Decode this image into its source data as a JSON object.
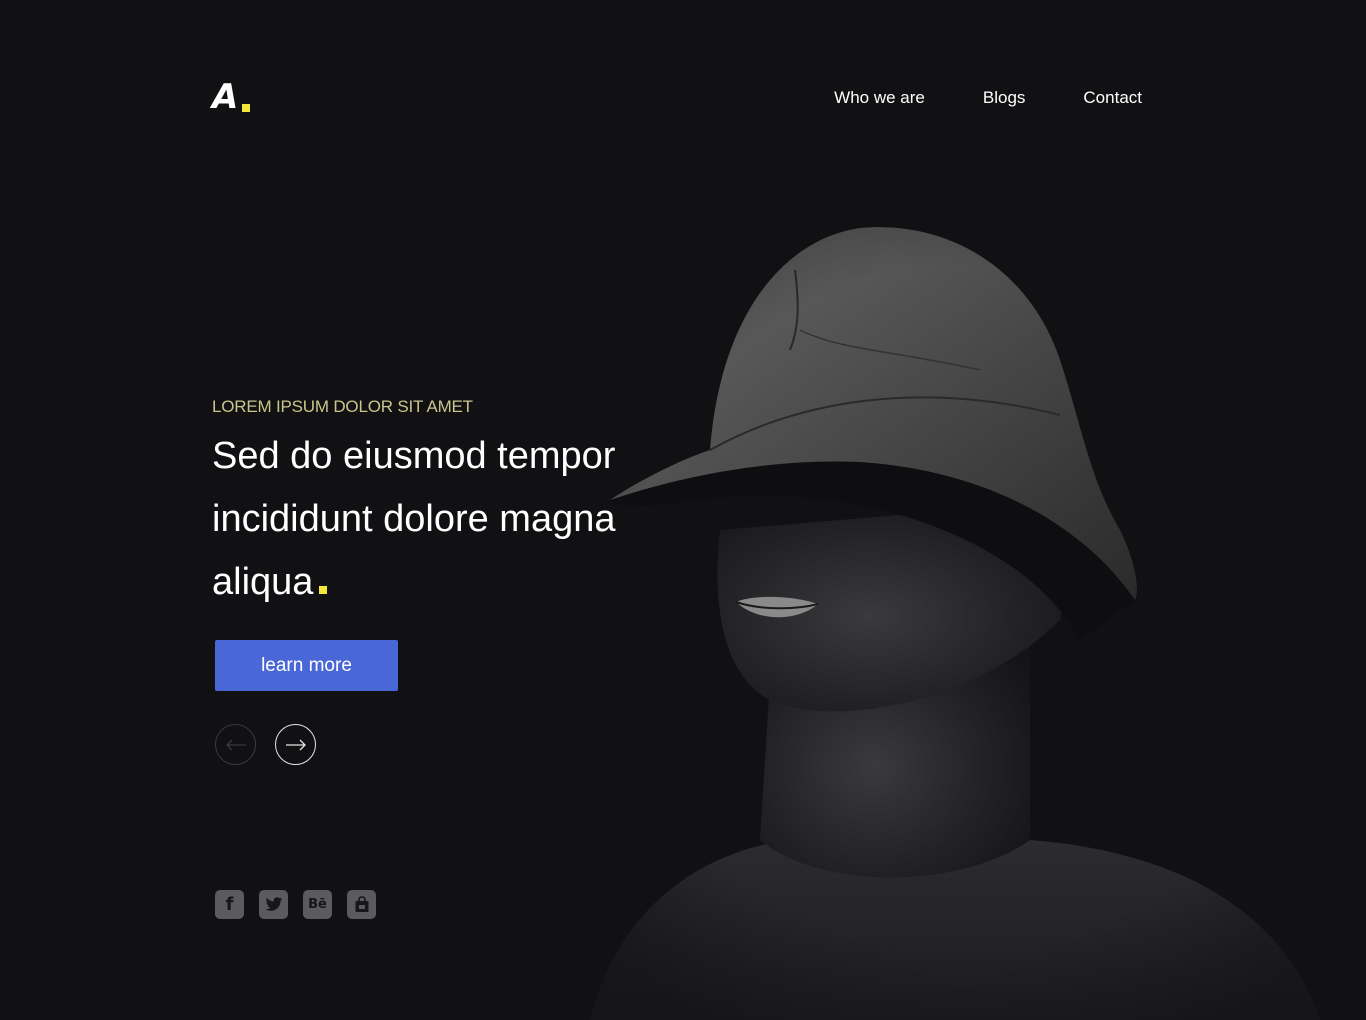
{
  "brand": {
    "logo_letter": "A",
    "accent_color": "#f5e63a"
  },
  "nav": {
    "items": [
      {
        "label": "Who we are"
      },
      {
        "label": "Blogs"
      },
      {
        "label": "Contact"
      }
    ]
  },
  "hero": {
    "eyebrow": "LOREM IPSUM DOLOR SIT AMET",
    "headline": "Sed do eiusmod tempor incididunt dolore magna aliqua",
    "cta_label": "learn more",
    "cta_color": "#4a67d8",
    "prev_icon": "arrow-left-icon",
    "next_icon": "arrow-right-icon"
  },
  "social": {
    "items": [
      {
        "icon": "facebook-icon"
      },
      {
        "icon": "twitter-icon"
      },
      {
        "icon": "behance-icon"
      },
      {
        "icon": "store-icon"
      }
    ]
  }
}
